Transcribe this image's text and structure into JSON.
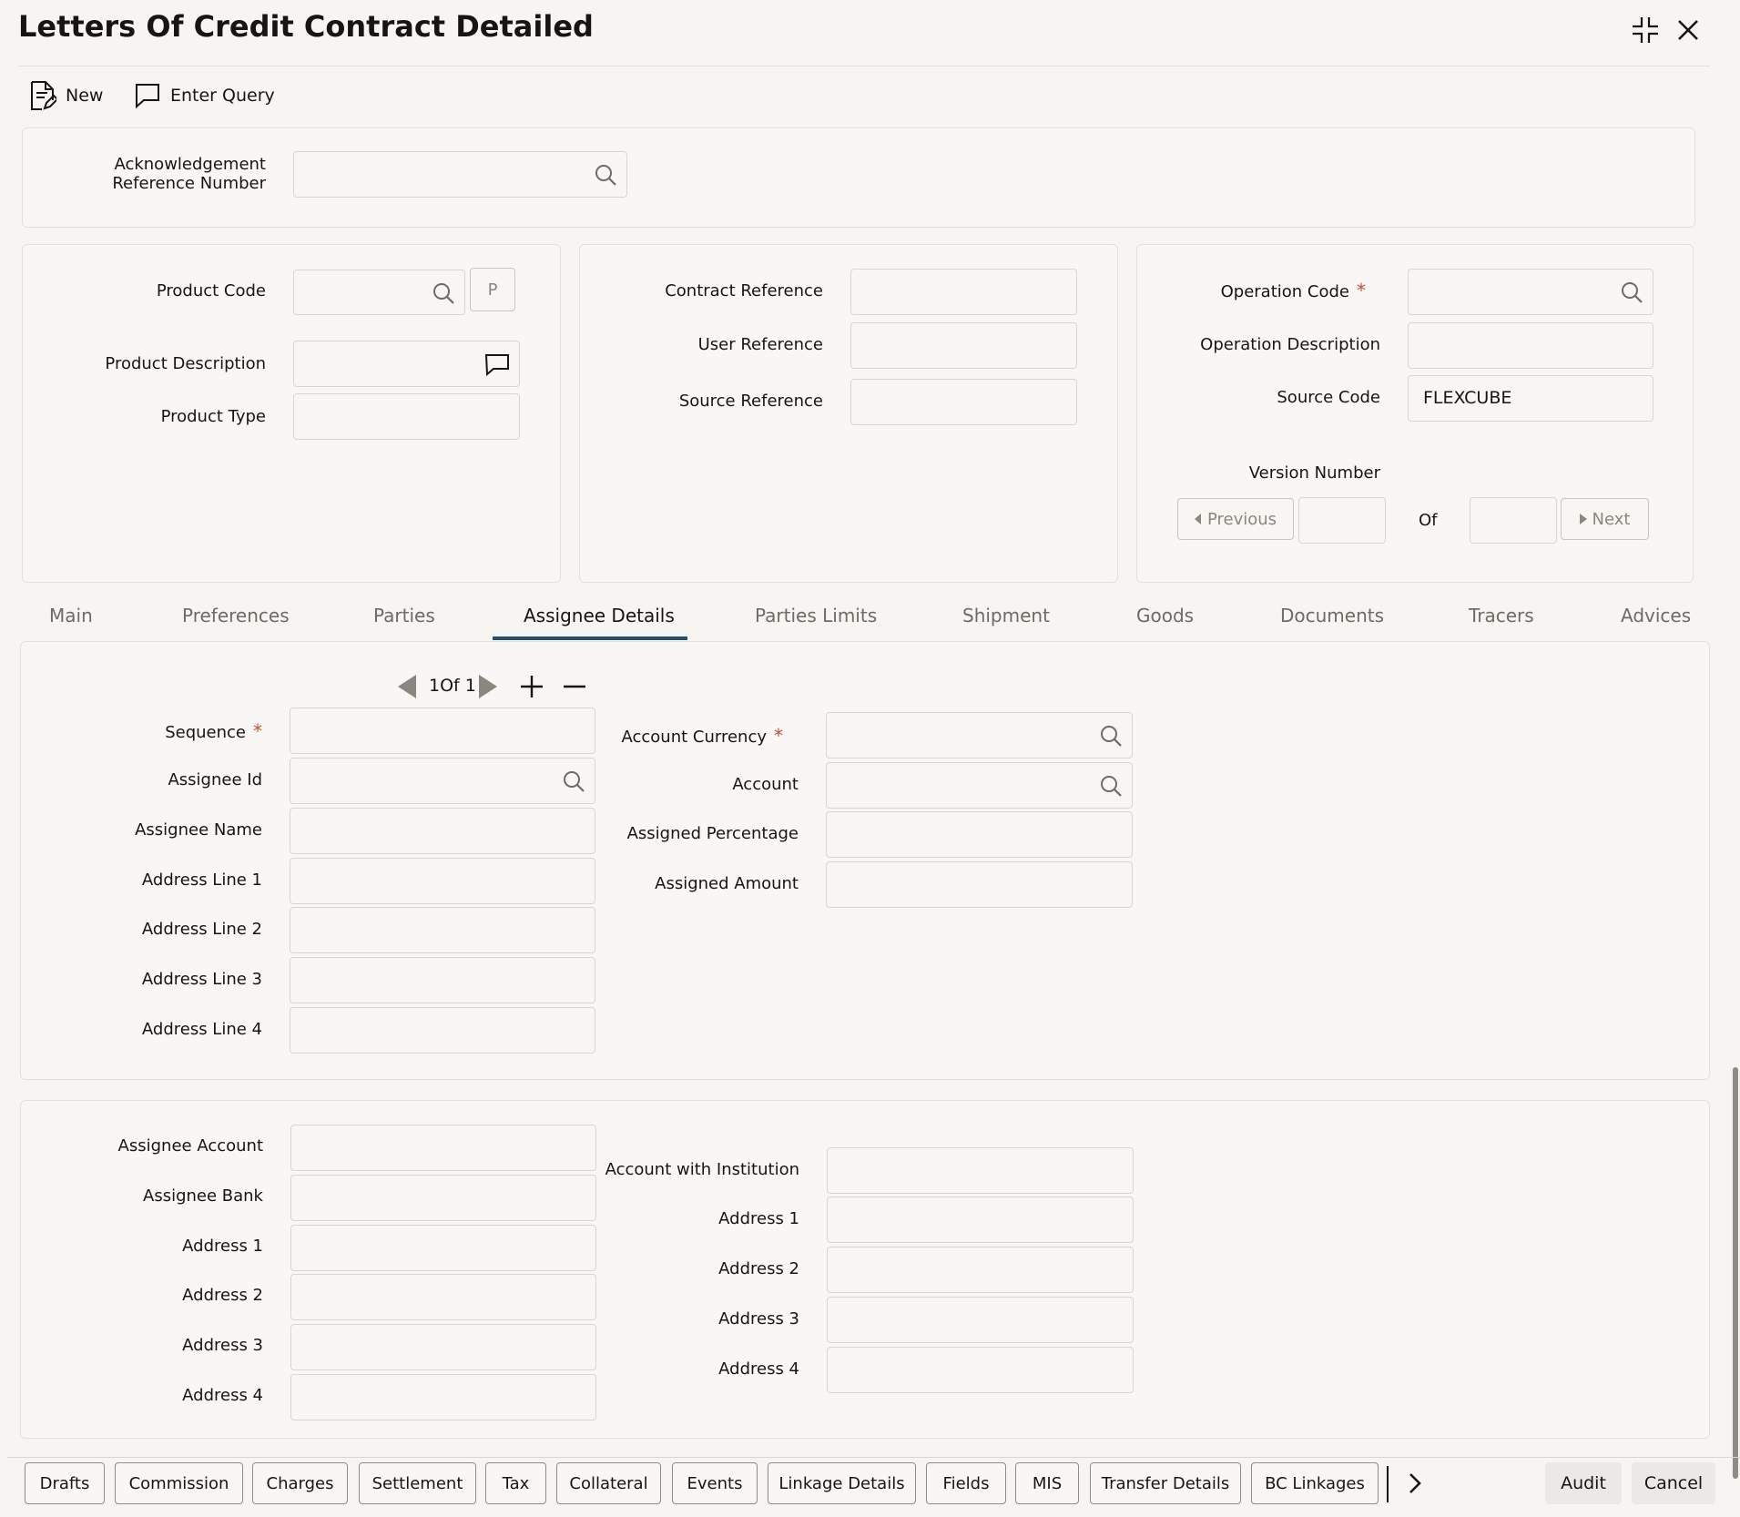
{
  "header": {
    "title": "Letters Of Credit Contract Detailed"
  },
  "toolbar": {
    "new_label": "New",
    "enter_query_label": "Enter Query"
  },
  "ack": {
    "label_line1": "Acknowledgement",
    "label_line2": "Reference Number",
    "value": ""
  },
  "product": {
    "code_label": "Product Code",
    "p_button": "P",
    "description_label": "Product Description",
    "type_label": "Product Type"
  },
  "contract": {
    "contract_ref_label": "Contract Reference",
    "user_ref_label": "User Reference",
    "source_ref_label": "Source Reference"
  },
  "operation": {
    "code_label": "Operation Code",
    "required_mark": "*",
    "description_label": "Operation Description",
    "source_code_label": "Source Code",
    "source_code_value": "FLEXCUBE",
    "version_label": "Version Number",
    "previous_label": "Previous",
    "of_label": "Of",
    "next_label": "Next"
  },
  "tabs": [
    "Main",
    "Preferences",
    "Parties",
    "Assignee Details",
    "Parties Limits",
    "Shipment",
    "Goods",
    "Documents",
    "Tracers",
    "Advices"
  ],
  "active_tab": "Assignee Details",
  "pager": {
    "text": "1Of 1"
  },
  "assignee": {
    "sequence_label": "Sequence",
    "id_label": "Assignee Id",
    "name_label": "Assignee Name",
    "addr1_label": "Address Line 1",
    "addr2_label": "Address Line 2",
    "addr3_label": "Address Line 3",
    "addr4_label": "Address Line 4",
    "account_currency_label": "Account Currency",
    "account_label": "Account",
    "assigned_percentage_label": "Assigned Percentage",
    "assigned_amount_label": "Assigned Amount"
  },
  "bank": {
    "account_label": "Assignee Account",
    "bank_label": "Assignee Bank",
    "address1_label": "Address 1",
    "address2_label": "Address 2",
    "address3_label": "Address 3",
    "address4_label": "Address 4",
    "awi_label": "Account with Institution",
    "awi_address1_label": "Address 1",
    "awi_address2_label": "Address 2",
    "awi_address3_label": "Address 3",
    "awi_address4_label": "Address 4"
  },
  "bottom_buttons": [
    "Drafts",
    "Commission",
    "Charges",
    "Settlement",
    "Tax",
    "Collateral",
    "Events",
    "Linkage Details",
    "Fields",
    "MIS",
    "Transfer Details",
    "BC Linkages"
  ],
  "footer": {
    "audit_label": "Audit",
    "cancel_label": "Cancel"
  },
  "icons": {
    "minimize": "minimize-icon",
    "close": "close-icon",
    "search": "search-icon",
    "comment": "comment-icon"
  },
  "colors": {
    "accent": "#234f6b",
    "required": "#c0522e",
    "background": "#f6f5f2"
  }
}
